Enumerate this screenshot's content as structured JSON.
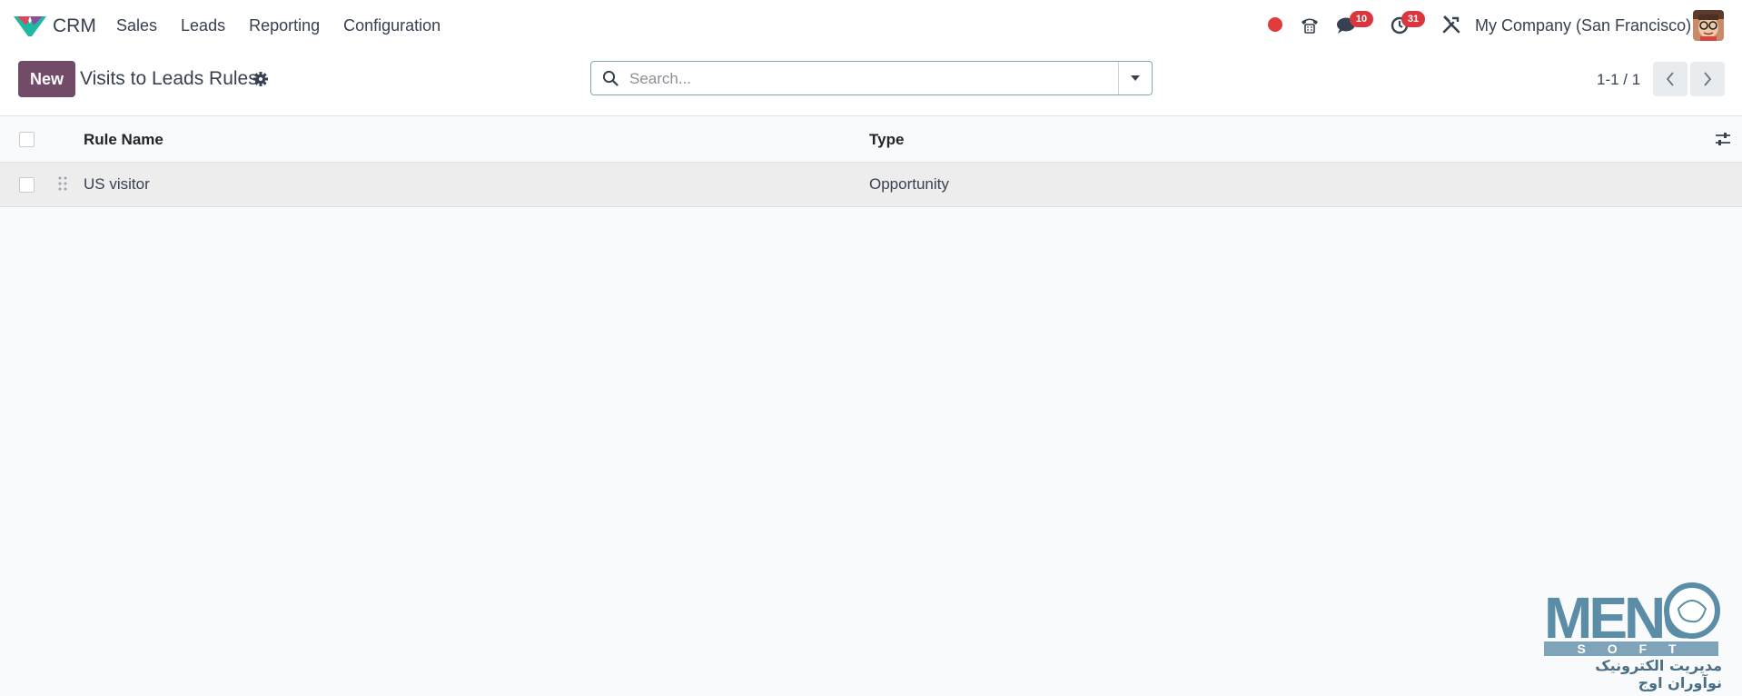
{
  "navbar": {
    "app_name": "CRM",
    "menu": [
      "Sales",
      "Leads",
      "Reporting",
      "Configuration"
    ],
    "messages_count": "10",
    "activities_count": "31",
    "company": "My Company (San Francisco)"
  },
  "control": {
    "new_label": "New",
    "title": "Visits to Leads Rules",
    "search_placeholder": "Search...",
    "pager": "1-1 / 1"
  },
  "table": {
    "columns": [
      "Rule Name",
      "Type"
    ],
    "rows": [
      {
        "rule_name": "US visitor",
        "type": "Opportunity"
      }
    ]
  },
  "watermark": {
    "brand": "MENO",
    "subtitle": "S O F T",
    "arabic": "مدیریت الکترونیک نوآوران اوج"
  },
  "colors": {
    "primary": "#714b67",
    "badge": "#d9363e",
    "status_dot": "#e03c3c"
  }
}
